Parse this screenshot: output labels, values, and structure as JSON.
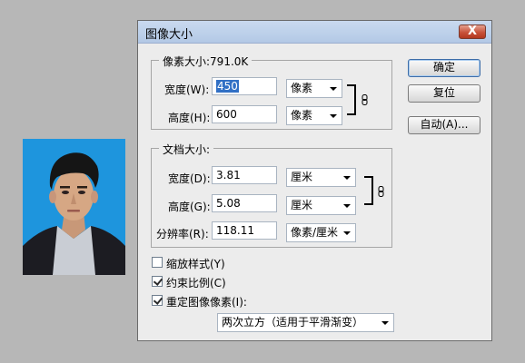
{
  "dialog": {
    "title": "图像大小",
    "close_symbol": "X"
  },
  "pixel_dimensions": {
    "label": "像素大小:791.0K",
    "width_label": "宽度(W):",
    "width_value": "450",
    "width_unit": "像素",
    "height_label": "高度(H):",
    "height_value": "600",
    "height_unit": "像素"
  },
  "document_size": {
    "label": "文档大小:",
    "width_label": "宽度(D):",
    "width_value": "3.81",
    "width_unit": "厘米",
    "height_label": "高度(G):",
    "height_value": "5.08",
    "height_unit": "厘米",
    "resolution_label": "分辨率(R):",
    "resolution_value": "118.11",
    "resolution_unit": "像素/厘米"
  },
  "options": {
    "scale_styles": {
      "label": "缩放样式(Y)",
      "checked": false
    },
    "constrain_proportions": {
      "label": "约束比例(C)",
      "checked": true
    },
    "resample_image": {
      "label": "重定图像像素(I):",
      "checked": true
    },
    "resample_method": "两次立方（适用于平滑渐变）"
  },
  "buttons": {
    "ok": "确定",
    "reset": "复位",
    "auto": "自动(A)..."
  },
  "colors": {
    "photo_background": "#1e95dd",
    "selection": "#3170c5",
    "close_button": "#c8523a"
  }
}
